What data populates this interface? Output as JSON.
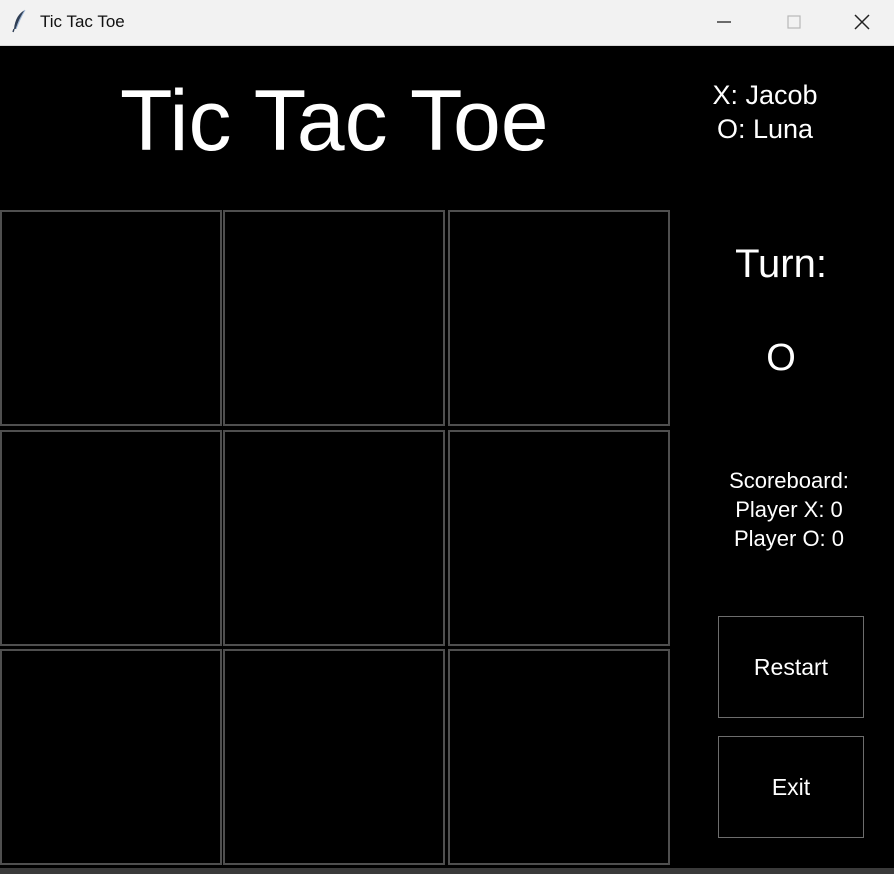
{
  "window": {
    "title": "Tic Tac Toe",
    "icon": "feather-icon"
  },
  "game": {
    "title": "Tic Tac Toe",
    "players": {
      "x_line": "X: Jacob",
      "o_line": "O: Luna"
    },
    "turn": {
      "label": "Turn:",
      "value": "O"
    },
    "scoreboard": {
      "title": "Scoreboard:",
      "player_x": "Player X: 0",
      "player_o": "Player O: 0"
    },
    "buttons": {
      "restart": "Restart",
      "exit": "Exit"
    },
    "board": [
      "",
      "",
      "",
      "",
      "",
      "",
      "",
      "",
      ""
    ]
  },
  "colors": {
    "background": "#000000",
    "text": "#ffffff",
    "grid": "#4f4f4f"
  }
}
